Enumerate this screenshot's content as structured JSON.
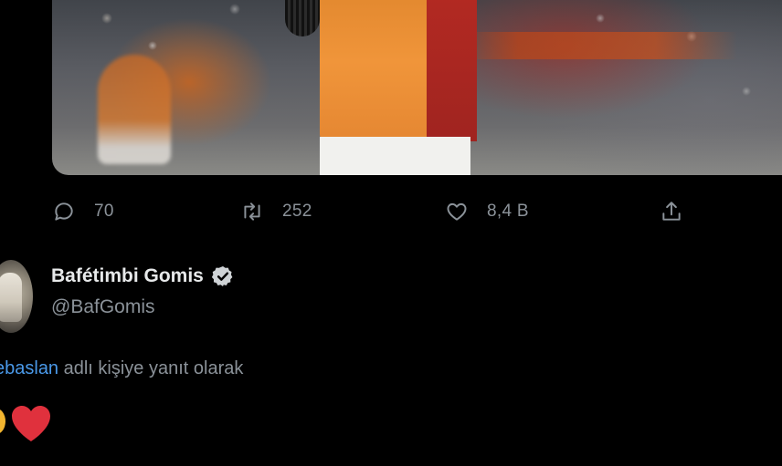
{
  "tweet": {
    "media": {
      "description_icon": "photo"
    },
    "actions": {
      "reply": {
        "icon": "reply-icon",
        "count": "70"
      },
      "retweet": {
        "icon": "retweet-icon",
        "count": "252"
      },
      "like": {
        "icon": "heart-outline-icon",
        "count": "8,4 B"
      },
      "share": {
        "icon": "share-icon"
      }
    }
  },
  "reply": {
    "author": {
      "name": "Bafétimbi Gomis",
      "handle": "@BafGomis",
      "verified": true
    },
    "replying_to": {
      "mention": "ebaslan",
      "suffix": " adlı kişiye yanıt olarak"
    },
    "emojis": [
      "partial-yellow-emoji",
      "red-heart-emoji"
    ]
  },
  "colors": {
    "background": "#000000",
    "text_primary": "#e7e9ea",
    "text_secondary": "#8b9299",
    "link": "#4a99e9",
    "heart": "#e0313d"
  }
}
